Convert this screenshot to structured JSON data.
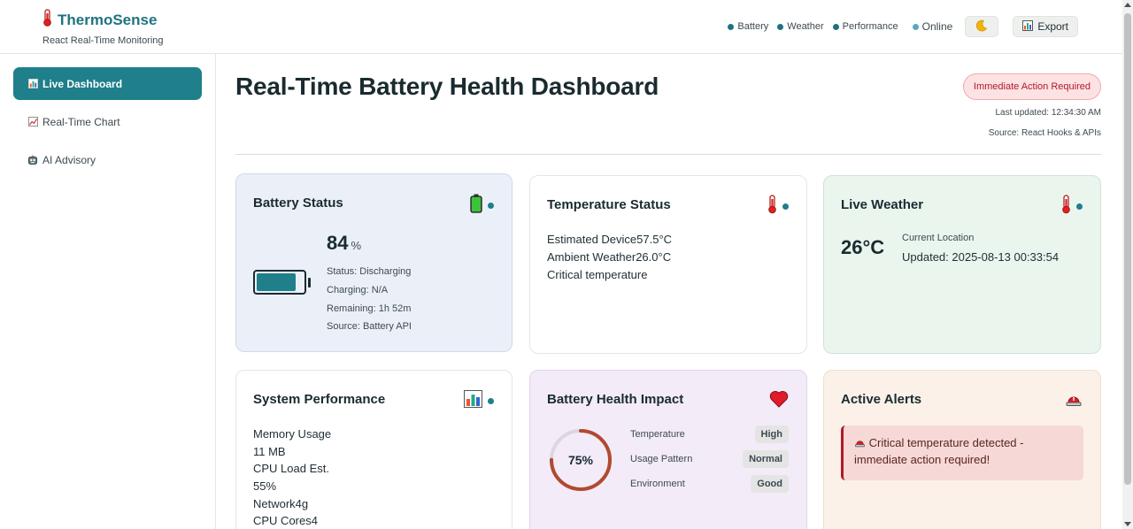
{
  "brand": {
    "title": "ThermoSense",
    "subtitle": "React Real-Time Monitoring"
  },
  "header": {
    "legend": [
      "Battery",
      "Weather",
      "Performance"
    ],
    "online_label": "Online",
    "theme_icon": "moon-icon",
    "export_label": "Export"
  },
  "sidebar": {
    "items": [
      {
        "label": "Live Dashboard",
        "icon": "bar-chart-icon",
        "active": true
      },
      {
        "label": "Real-Time Chart",
        "icon": "line-chart-icon",
        "active": false
      },
      {
        "label": "AI Advisory",
        "icon": "robot-icon",
        "active": false
      }
    ]
  },
  "main": {
    "title": "Real-Time Battery Health Dashboard",
    "alert_pill": "Immediate Action Required",
    "last_updated": "Last updated: 12:34:30 AM",
    "source": "Source: React Hooks & APIs"
  },
  "battery": {
    "title": "Battery Status",
    "percent": "84",
    "percent_value": 84,
    "unit": "%",
    "status": "Status: Discharging",
    "charging": "Charging: N/A",
    "remaining": "Remaining: 1h 52m",
    "source": "Source: Battery API"
  },
  "temperature": {
    "title": "Temperature Status",
    "device": "Estimated Device57.5°C",
    "ambient": "Ambient Weather26.0°C",
    "level": "Critical temperature"
  },
  "weather": {
    "title": "Live Weather",
    "temp": "26°C",
    "location": "Current Location",
    "updated": "Updated: 2025-08-13 00:33:54"
  },
  "performance": {
    "title": "System Performance",
    "memory_label": "Memory Usage",
    "memory_value": "11 MB",
    "cpu_label": "CPU Load Est.",
    "cpu_value": "55%",
    "network": "Network4g",
    "cores": "CPU Cores4"
  },
  "health": {
    "title": "Battery Health Impact",
    "score": "75%",
    "score_value": 0.75,
    "factors": [
      {
        "label": "Temperature",
        "value": "High"
      },
      {
        "label": "Usage Pattern",
        "value": "Normal"
      },
      {
        "label": "Environment",
        "value": "Good"
      }
    ]
  },
  "alerts": {
    "title": "Active Alerts",
    "items": [
      "Critical temperature detected - immediate action required!"
    ]
  },
  "colors": {
    "accent": "#1f7f8b",
    "danger": "#b0182a",
    "health_ring": "#b04a30"
  }
}
